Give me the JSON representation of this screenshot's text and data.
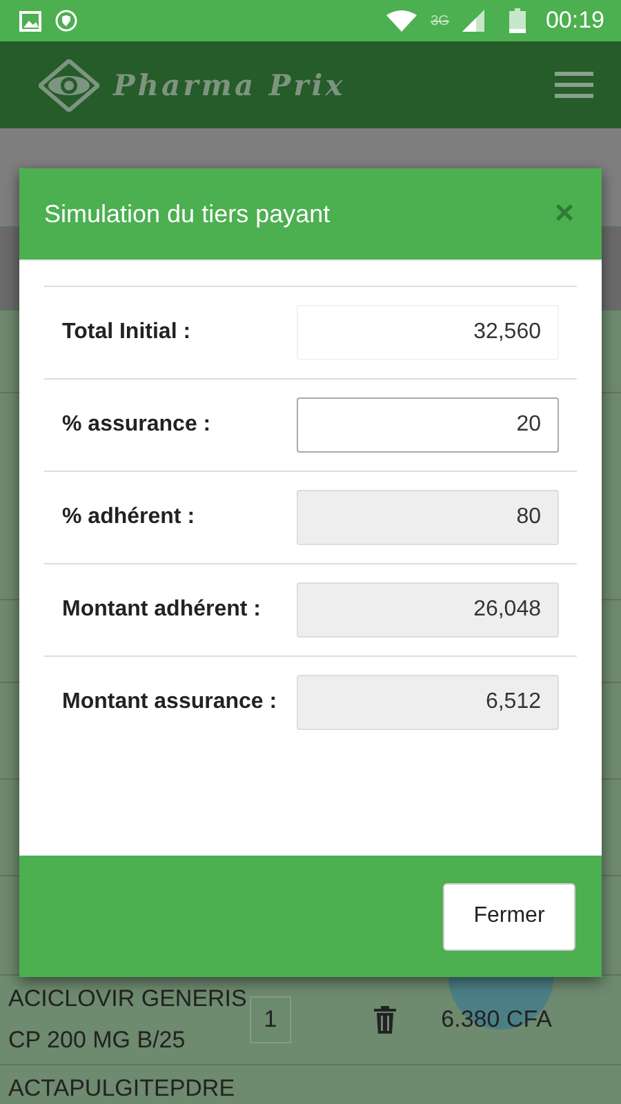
{
  "status_bar": {
    "network": "3G",
    "time": "00:19"
  },
  "app_bar": {
    "title": "Pharma Prix"
  },
  "rows": [
    {
      "lines": [
        "ACICLOVIR GENERIS",
        "CP 200 MG B/25"
      ],
      "quantity": "1",
      "price": "6.380 CFA"
    },
    {
      "lines": [
        "ACTAPULGITEPDRE"
      ]
    }
  ],
  "dialog": {
    "title": "Simulation du tiers payant",
    "close": "×",
    "fields": [
      {
        "label": "Total Initial :",
        "value": "32,560",
        "kind": "plain"
      },
      {
        "label": "% assurance :",
        "value": "20",
        "kind": "input"
      },
      {
        "label": "% adhérent :",
        "value": "80",
        "kind": "disabled"
      },
      {
        "label": "Montant adhérent :",
        "value": "26,048",
        "kind": "disabled"
      },
      {
        "label": "Montant assurance :",
        "value": "6,512",
        "kind": "disabled"
      }
    ],
    "button": "Fermer"
  }
}
